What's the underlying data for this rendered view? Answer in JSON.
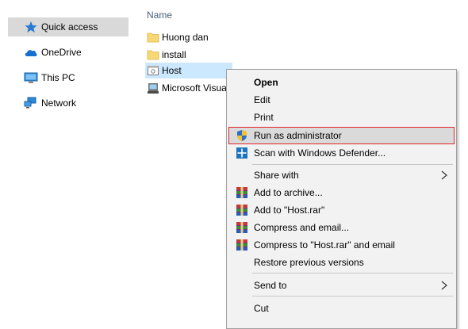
{
  "nav": {
    "items": [
      {
        "label": "Quick access",
        "icon": "star-pin-icon",
        "selected": true
      },
      {
        "label": "OneDrive",
        "icon": "cloud-icon"
      },
      {
        "label": "This PC",
        "icon": "computer-icon"
      },
      {
        "label": "Network",
        "icon": "network-icon"
      }
    ]
  },
  "files": {
    "column_header": "Name",
    "items": [
      {
        "label": "Huong dan",
        "icon": "folder-icon"
      },
      {
        "label": "install",
        "icon": "folder-icon"
      },
      {
        "label": "Host",
        "icon": "application-icon",
        "selected": true
      },
      {
        "label": "Microsoft Visua",
        "icon": "installer-icon"
      }
    ]
  },
  "context_menu": {
    "items": [
      {
        "label": "Open",
        "bold": true
      },
      {
        "label": "Edit"
      },
      {
        "label": "Print"
      },
      {
        "label": "Run as administrator",
        "icon": "uac-shield-icon",
        "highlighted": true
      },
      {
        "label": "Scan with Windows Defender...",
        "icon": "defender-icon"
      },
      {
        "label": "Share with",
        "submenu": true
      },
      {
        "label": "Add to archive...",
        "icon": "winrar-icon"
      },
      {
        "label": "Add to \"Host.rar\"",
        "icon": "winrar-icon"
      },
      {
        "label": "Compress and email...",
        "icon": "winrar-icon"
      },
      {
        "label": "Compress to \"Host.rar\" and email",
        "icon": "winrar-icon"
      },
      {
        "label": "Restore previous versions"
      },
      {
        "label": "Send to",
        "submenu": true
      },
      {
        "label": "Cut"
      }
    ]
  },
  "colors": {
    "selection": "#cce8ff",
    "highlight_border": "#e0262c",
    "menu_bg": "#f2f2f2"
  }
}
